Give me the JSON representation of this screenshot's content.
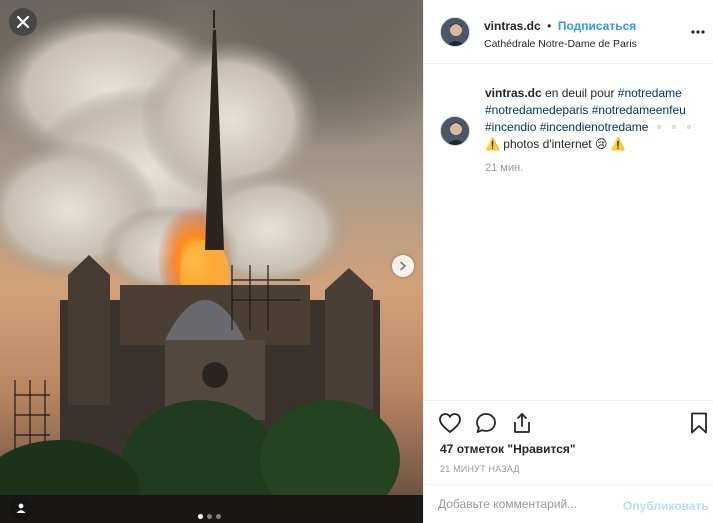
{
  "post": {
    "username": "vintras.dc",
    "bullet": "•",
    "follow_label": "Подписаться",
    "location": "Cathédrale Notre-Dame de Paris",
    "caption": {
      "text_prefix": "en deuil pour",
      "hashtags": [
        "#notredame",
        "#notredamedeparis",
        "#notredameenfeu",
        "#incendio",
        "#incendienotredame"
      ],
      "emoji_line": "▫️▫️▫️",
      "line2": "⚠️ photos d'internet 😢 ⚠️"
    },
    "caption_time": "21 мин.",
    "likes_count": "47",
    "likes_text": "отметок \"Нравится\"",
    "timestamp": "21 МИНУТ НАЗАД",
    "comment_placeholder": "Добавьте комментарий...",
    "post_label": "Опубликовать"
  },
  "carousel": {
    "slides": 3,
    "active": 0
  },
  "icons": {
    "close": "close-icon",
    "next": "chevron-right-icon",
    "user_tag": "user-tag-icon",
    "more": "more-options-icon",
    "like": "heart-icon",
    "comment": "comment-icon",
    "share": "share-icon",
    "save": "bookmark-icon"
  },
  "colors": {
    "link_blue": "#3897f0",
    "hashtag": "#003569",
    "muted": "#999999",
    "post_button_disabled": "#b2dffc"
  }
}
